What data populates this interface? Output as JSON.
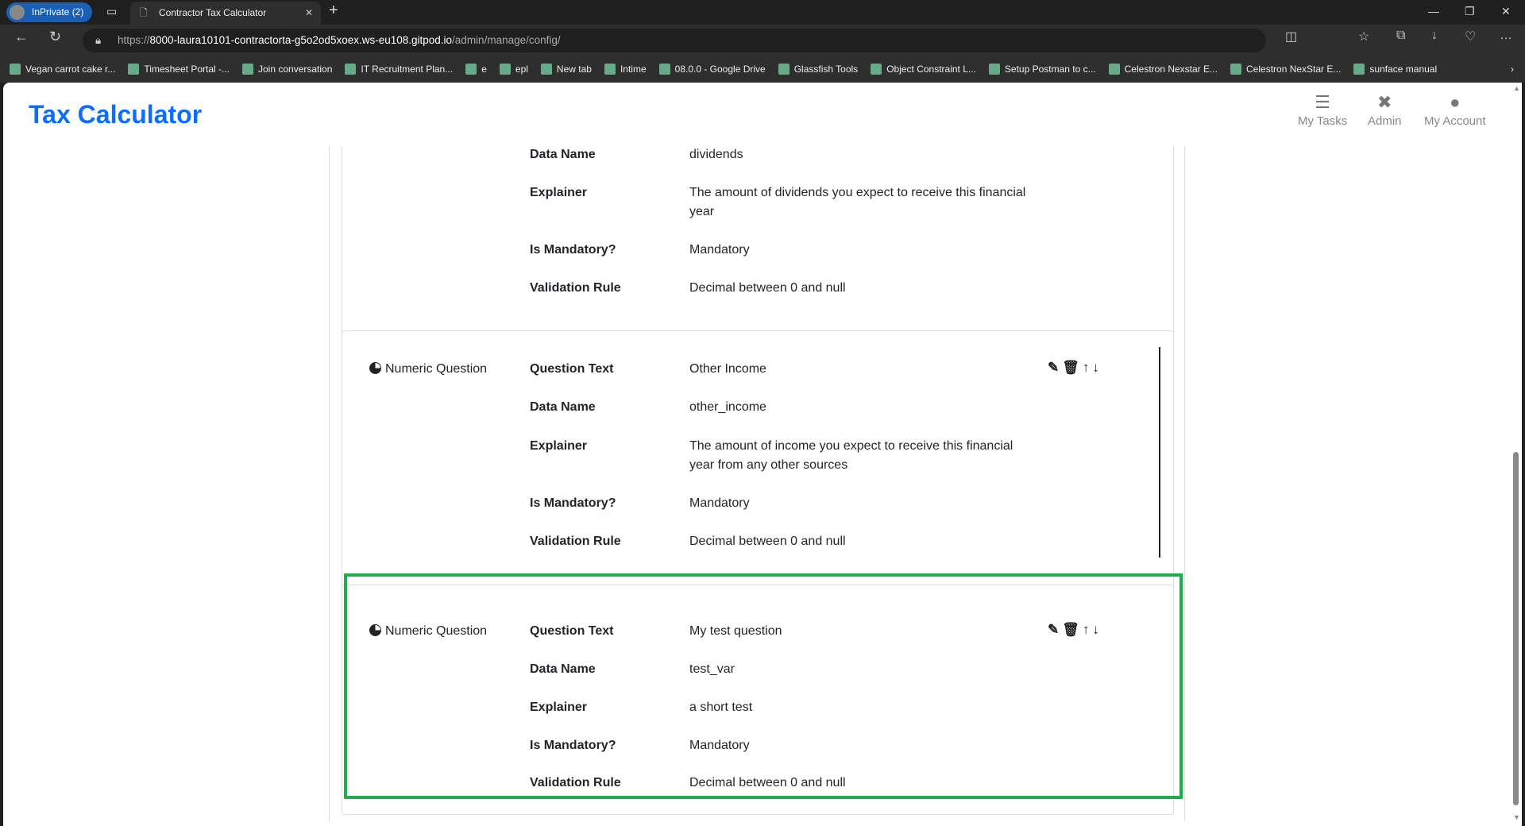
{
  "browser": {
    "profile": "InPrivate (2)",
    "tab_title": "Contractor Tax Calculator",
    "url_scheme": "https://",
    "url_host": "8000-laura10101-contractorta-g5o2od5xoex.ws-eu108.gitpod.io",
    "url_path": "/admin/manage/config/",
    "bookmarks": [
      "Vegan carrot cake r...",
      "Timesheet Portal -...",
      "Join conversation",
      "IT Recruitment Plan...",
      "e",
      "epl",
      "New tab",
      "Intime",
      "08.0.0 - Google Drive",
      "Glassfish Tools",
      "Object Constraint L...",
      "Setup Postman to c...",
      "Celestron Nexstar E...",
      "Celestron NexStar E...",
      "sunface manual"
    ]
  },
  "app": {
    "title": "Tax Calculator",
    "nav": [
      {
        "label": "My Tasks",
        "icon": "tasks-icon"
      },
      {
        "label": "Admin",
        "icon": "tools-icon"
      },
      {
        "label": "My Account",
        "icon": "user-icon"
      }
    ]
  },
  "labels": {
    "question_text": "Question Text",
    "data_name": "Data Name",
    "explainer": "Explainer",
    "mandatory": "Is Mandatory?",
    "validation": "Validation Rule"
  },
  "questions": [
    {
      "type": "",
      "question_text": "",
      "data_name": "dividends",
      "explainer": "The amount of dividends you expect to receive this financial year",
      "mandatory": "Mandatory",
      "validation": "Decimal between 0 and null"
    },
    {
      "type": "Numeric Question",
      "question_text": "Other Income",
      "data_name": "other_income",
      "explainer": "The amount of income you expect to receive this financial year from any other sources",
      "mandatory": "Mandatory",
      "validation": "Decimal between 0 and null"
    },
    {
      "type": "Numeric Question",
      "question_text": "My test question",
      "data_name": "test_var",
      "explainer": "a short test",
      "mandatory": "Mandatory",
      "validation": "Decimal between 0 and null"
    }
  ],
  "colors": {
    "brand": "#0d6efd",
    "highlight": "#1fac4d"
  }
}
